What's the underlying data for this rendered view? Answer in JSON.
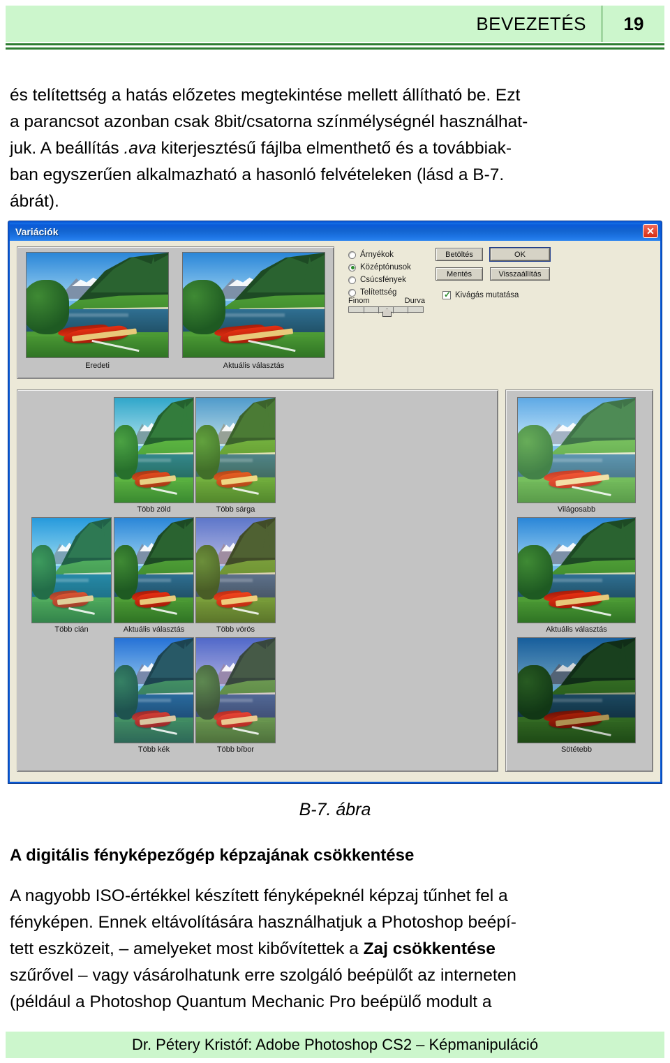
{
  "header": {
    "title": "BEVEZETÉS",
    "page_number": "19",
    "bg_color": "#ccf6cc",
    "rule_color": "#2e7d32"
  },
  "intro_paragraph": {
    "line1": "és telítettség a hatás előzetes megtekintése mellett állítható be. Ezt",
    "line2": "a parancsot azonban csak 8bit/csatorna színmélységnél használhat-",
    "line3_a": "juk. A beállítás ",
    "line3_italic": ".ava",
    "line3_b": " kiterjesztésű fájlba elmenthető és a továbbiak-",
    "line4": "ban egyszerűen alkalmazható a hasonló felvételeken (lásd a B-7.",
    "line5": "ábrát)."
  },
  "dialog": {
    "title": "Variációk",
    "close_label": "✕",
    "titlebar_color": "#0a5ad8",
    "body_color": "#ece9d8",
    "panel_color": "#c3c3c3",
    "preview": {
      "original_label": "Eredeti",
      "current_label": "Aktuális választás"
    },
    "radios": {
      "items": [
        {
          "label": "Árnyékok",
          "accel": "o",
          "checked": false
        },
        {
          "label": "Középtónusok",
          "accel": "t",
          "checked": true
        },
        {
          "label": "Csúcsfények",
          "accel": "c",
          "checked": false
        },
        {
          "label": "Telítettség",
          "accel": "l",
          "checked": false
        }
      ]
    },
    "slider": {
      "min_label": "Finom",
      "max_label": "Durva",
      "value": 2,
      "ticks": 5
    },
    "buttons": {
      "load": "Betöltés",
      "ok": "OK",
      "save": "Mentés",
      "reset": "Visszaállítás"
    },
    "checkbox": {
      "label": "Kivágás mutatása",
      "checked": true
    },
    "grid": {
      "r1c2": "Több zöld",
      "r1c3": "Több sárga",
      "r2c1": "Több cián",
      "r2c2": "Aktuális választás",
      "r2c3": "Több vörös",
      "r3c2": "Több kék",
      "r3c3": "Több bíbor"
    },
    "side": {
      "lighter": "Világosabb",
      "current": "Aktuális választás",
      "darker": "Sötétebb"
    }
  },
  "figure_caption": "B-7. ábra",
  "section_heading": "A digitális fényképezőgép képzajának csökkentése",
  "body_paragraph": {
    "line1": "A nagyobb ISO-értékkel készített fényképeknél képzaj tűnhet fel a",
    "line2": "fényképen. Ennek eltávolítására használhatjuk a Photoshop beépí-",
    "line3_a": "tett eszközeit, – amelyeket most kibővítettek a ",
    "line3_bold": "Zaj csökkentése",
    "line4": "szűrővel – vagy vásárolhatunk erre szolgáló beépülőt az interneten",
    "line5": "(például a Photoshop Quantum Mechanic Pro beépülő modult a"
  },
  "footer": {
    "text": "Dr. Pétery Kristóf: Adobe Photoshop CS2 – Képmanipuláció",
    "bg_color": "#ccf6cc"
  }
}
